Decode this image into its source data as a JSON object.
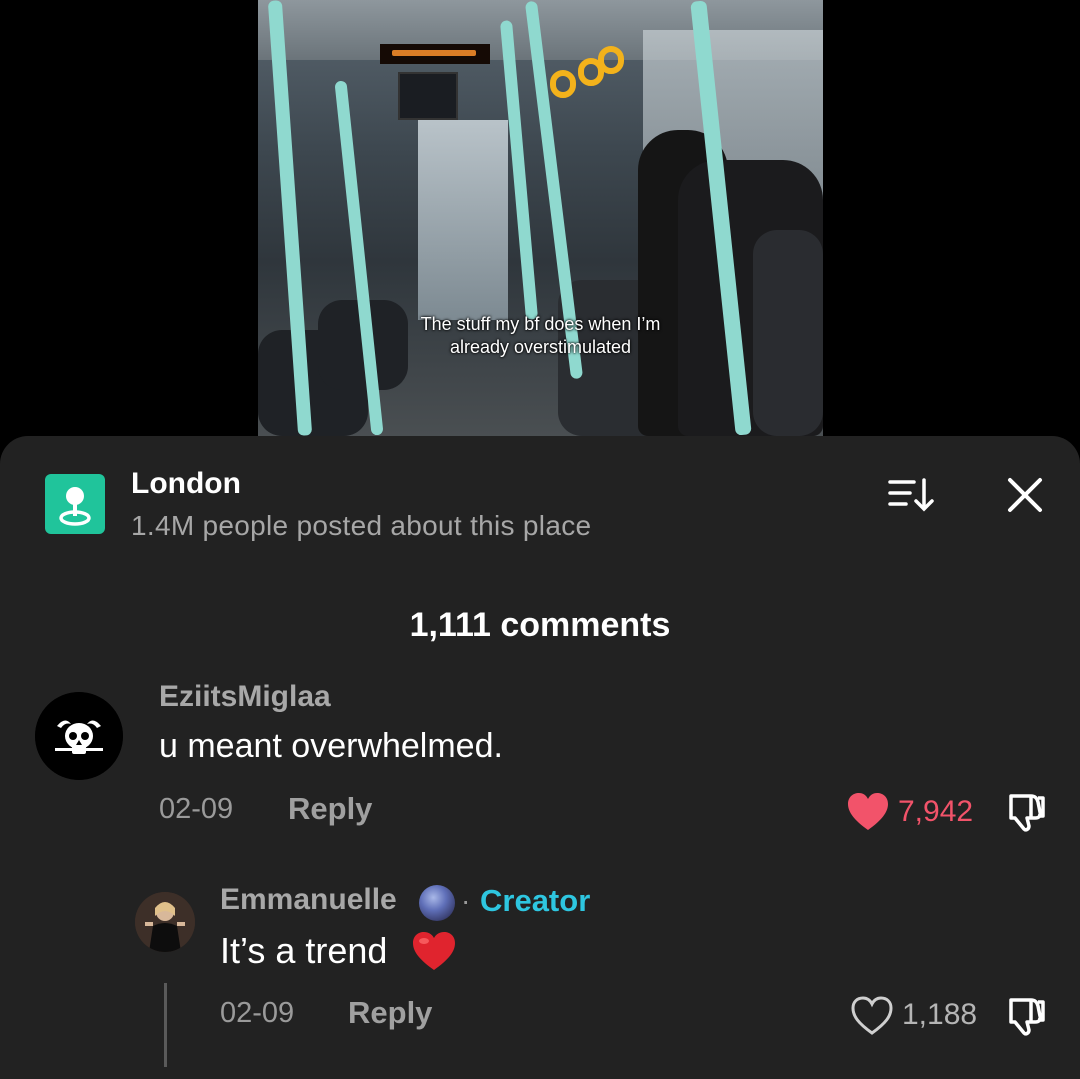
{
  "video": {
    "caption_line1": "The stuff my bf does when I’m",
    "caption_line2": "already overstimulated"
  },
  "location": {
    "icon": "location-pin-icon",
    "title": "London",
    "subtitle": "1.4M people posted about this place",
    "accent": "#20c49b"
  },
  "header": {
    "sort_icon": "sort-icon",
    "close_icon": "close-icon"
  },
  "comments_count": "1,111 comments",
  "comments": [
    {
      "username": "EziitsMiglaa",
      "text": "u meant overwhelmed.",
      "date": "02-09",
      "reply_label": "Reply",
      "likes": "7,942",
      "liked": true,
      "like_color": "#f2536a"
    }
  ],
  "replies": [
    {
      "username": "Emmanuelle",
      "badge_icon": "globe-emoji-icon",
      "separator": "·",
      "creator_label": "Creator",
      "creator_color": "#2ec6e0",
      "text": "It’s a trend",
      "emoji_icon": "red-heart-emoji-icon",
      "date": "02-09",
      "reply_label": "Reply",
      "likes": "1,188",
      "liked": false
    }
  ]
}
